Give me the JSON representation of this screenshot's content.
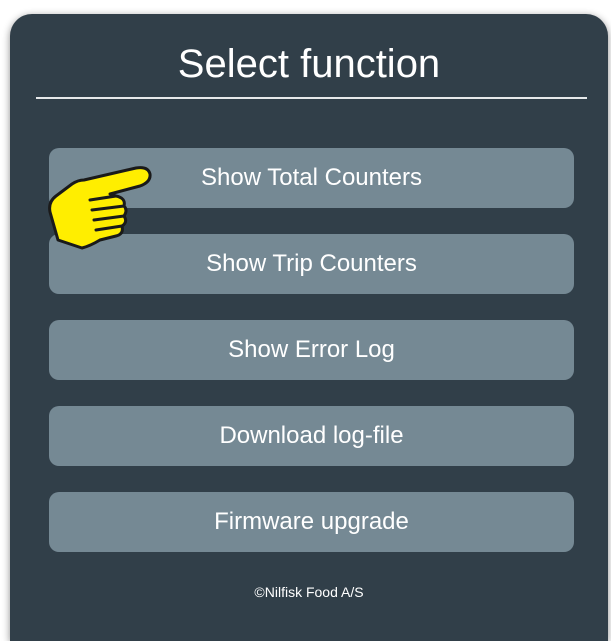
{
  "panel": {
    "title": "Select function",
    "buttons": [
      {
        "label": "Show Total Counters"
      },
      {
        "label": "Show Trip Counters"
      },
      {
        "label": "Show Error Log"
      },
      {
        "label": "Download log-file"
      },
      {
        "label": "Firmware upgrade"
      }
    ],
    "footer": "©Nilfisk Food A/S"
  },
  "colors": {
    "panel_bg": "#313f49",
    "button_bg": "#758994",
    "text": "#ffffff",
    "pointer_fill": "#ffee00"
  },
  "icons": {
    "pointer": "pointing-hand-icon"
  }
}
